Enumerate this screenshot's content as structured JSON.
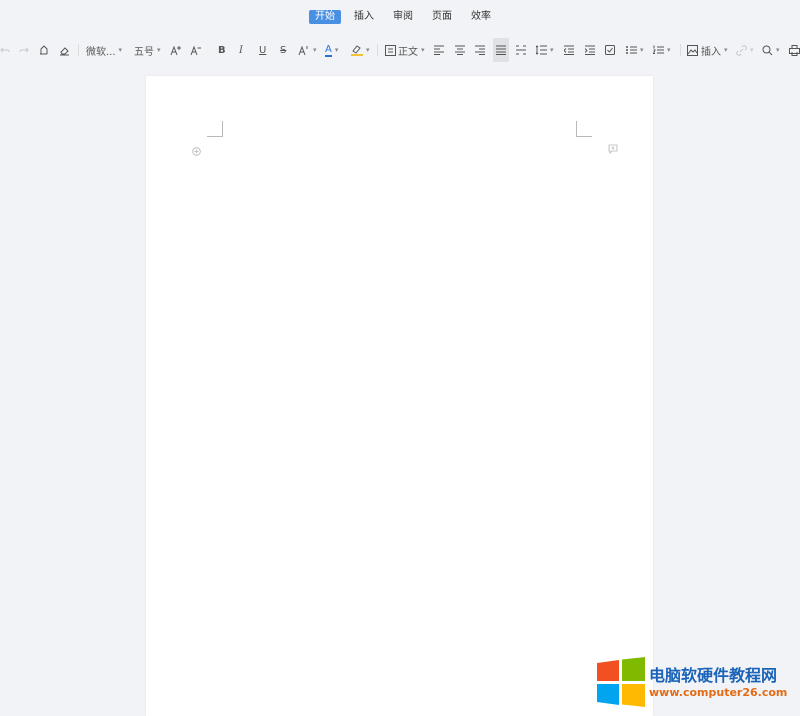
{
  "menu": {
    "tabs": [
      {
        "label": "开始",
        "active": true
      },
      {
        "label": "插入",
        "active": false
      },
      {
        "label": "审阅",
        "active": false
      },
      {
        "label": "页面",
        "active": false
      },
      {
        "label": "效率",
        "active": false
      }
    ]
  },
  "toolbar": {
    "font_name": "微软...",
    "font_size": "五号",
    "bold": "B",
    "italic": "I",
    "underline": "U",
    "strikethrough": "S",
    "font_color_letter": "A",
    "paragraph_style": "正文",
    "insert_label": "插入"
  },
  "watermark": {
    "title": "电脑软硬件教程网",
    "url": "www.computer26.com"
  },
  "colors": {
    "accent": "#4a90e2",
    "background": "#f2f3f6",
    "page": "#ffffff",
    "font_color_underline": "#2f6fd6",
    "highlight_underline": "#f1c232",
    "watermark_title": "#1a63b8",
    "watermark_url": "#e36b16"
  }
}
